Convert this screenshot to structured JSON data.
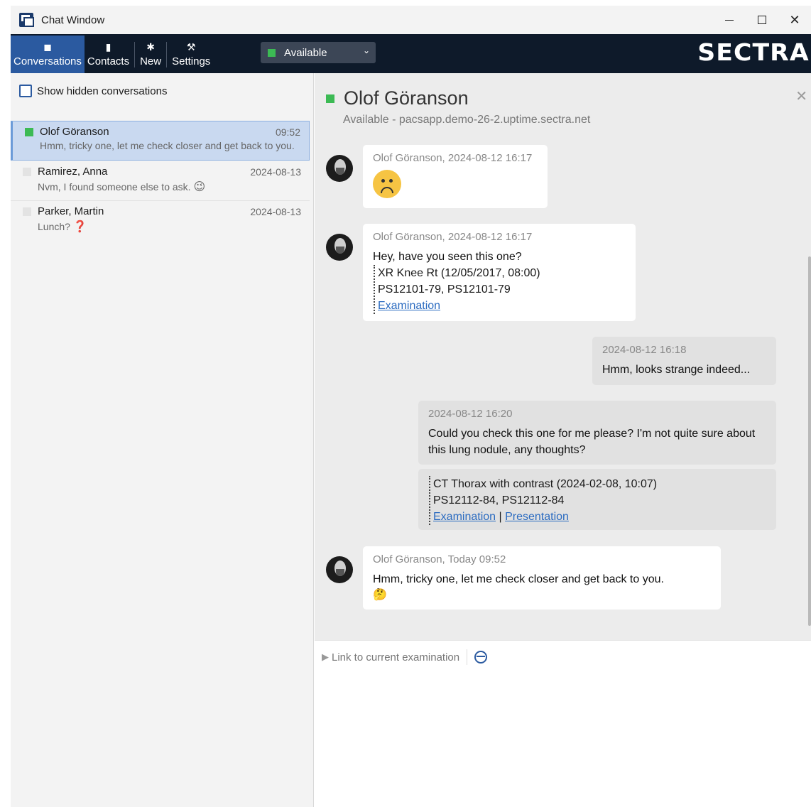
{
  "window": {
    "title": "Chat Window"
  },
  "toolbar": {
    "conversations": "Conversations",
    "contacts": "Contacts",
    "new": "New",
    "settings": "Settings",
    "status": "Available",
    "logo": "SECTRA"
  },
  "sidebar": {
    "show_hidden": "Show hidden conversations",
    "conversations": [
      {
        "name": "Olof Göranson",
        "time": "09:52",
        "preview": "Hmm, tricky one, let me check closer and get back to you.",
        "online": true,
        "selected": true
      },
      {
        "name": "Ramirez, Anna",
        "time": "2024-08-13",
        "preview": "Nvm, I found someone else to ask.",
        "preview_emoji": "😉",
        "online": false
      },
      {
        "name": "Parker, Martin",
        "time": "2024-08-13",
        "preview": "Lunch?",
        "preview_emoji": "❓",
        "online": false
      }
    ]
  },
  "chat": {
    "contact_name": "Olof Göranson",
    "contact_status": "Available - pacsapp.demo-26-2.uptime.sectra.net",
    "messages": [
      {
        "dir": "in",
        "meta": "Olof Göranson, 2024-08-12 16:17",
        "emoji": "sad-face"
      },
      {
        "dir": "in",
        "meta": "Olof Göranson, 2024-08-12 16:17",
        "text": "Hey, have you seen this one?",
        "ref_lines": [
          "XR Knee Rt (12/05/2017, 08:00)",
          "PS12101-79, PS12101-79"
        ],
        "links": [
          "Examination"
        ]
      },
      {
        "dir": "out",
        "meta": "2024-08-12 16:18",
        "text": "Hmm, looks strange indeed..."
      },
      {
        "dir": "out",
        "meta": "2024-08-12 16:20",
        "text": "Could you check this one for me please? I'm not quite sure about this lung nodule, any thoughts?",
        "ref_lines": [
          "CT Thorax with contrast (2024-02-08, 10:07)",
          "PS12112-84, PS12112-84"
        ],
        "links": [
          "Examination",
          "Presentation"
        ],
        "link_sep": "|"
      },
      {
        "dir": "in",
        "meta": "Olof Göranson, Today 09:52",
        "text": "Hmm, tricky one, let me check closer and get back to you.",
        "emoji": "🤔"
      }
    ]
  },
  "compose": {
    "link_label": "Link to current examination",
    "placeholder": ""
  },
  "colors": {
    "accent": "#2b5aa0",
    "online": "#3cba54",
    "toolbar_bg": "#0e1a2a"
  }
}
